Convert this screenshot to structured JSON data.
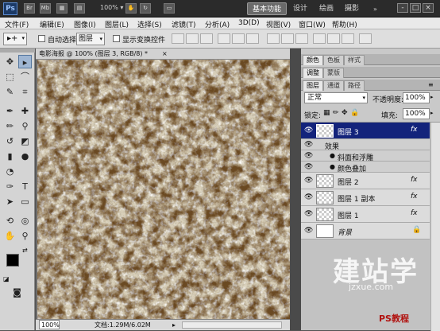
{
  "appbar": {
    "logo": "Ps",
    "icons": [
      "Br",
      "Mb"
    ],
    "zoom_1": "100%",
    "zoom_2": "100%",
    "workspaces": [
      "基本功能",
      "设计",
      "绘画",
      "摄影"
    ],
    "window_buttons": [
      "-",
      "□",
      "×"
    ]
  },
  "menu": [
    "文件(F)",
    "编辑(E)",
    "图像(I)",
    "图层(L)",
    "选择(S)",
    "滤镜(T)",
    "分析(A)",
    "3D(D)",
    "视图(V)",
    "窗口(W)",
    "帮助(H)"
  ],
  "options": {
    "auto_select_label": "自动选择:",
    "auto_select_value": "图层",
    "show_transform_label": "显示变换控件"
  },
  "document": {
    "tab_title": "电影海报 @ 100% (图层 3, RGB/8) *",
    "zoom": "100%",
    "doc_info": "文档:1.29M/6.02M"
  },
  "panels": {
    "tabs_row1": [
      "颜色",
      "色板",
      "样式"
    ],
    "tabs_row2": [
      "调整",
      "蒙版"
    ],
    "tabs_row3": [
      "图层",
      "通道",
      "路径"
    ],
    "blend_mode": "正常",
    "opacity_label": "不透明度:",
    "opacity_value": "100%",
    "lock_label": "锁定:",
    "fill_label": "填充:",
    "fill_value": "100%",
    "layers": [
      {
        "name": "图层 3",
        "selected": true,
        "fx": "fx"
      },
      {
        "name": "效果",
        "effect": true
      },
      {
        "name": "斜面和浮雕",
        "effect_item": true
      },
      {
        "name": "颜色叠加",
        "effect_item": true
      },
      {
        "name": "图层 2",
        "fx": "fx"
      },
      {
        "name": "图层 1 副本",
        "fx": "fx"
      },
      {
        "name": "图层 1",
        "fx": "fx"
      },
      {
        "name": "背景",
        "background": true
      }
    ]
  },
  "watermark": {
    "text_big": "建站学",
    "text_small": "jzxue.com",
    "brand": "PS教程"
  },
  "colors": {
    "appbar": "#2b2b2b",
    "selected_layer": "#13237b",
    "canvas_base": "#d8cfb9"
  }
}
